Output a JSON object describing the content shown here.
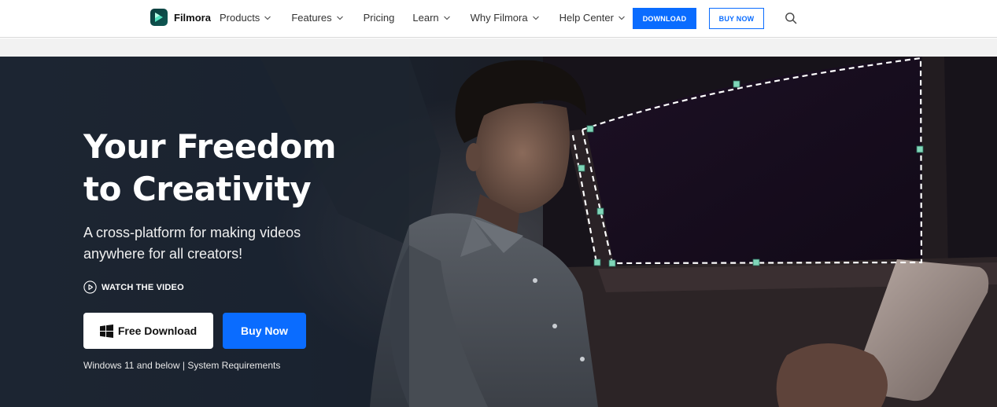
{
  "brand": {
    "name": "Filmora",
    "logo_icon": "filmora-logo-icon"
  },
  "nav": {
    "items": [
      {
        "label": "Products",
        "has_dropdown": true
      },
      {
        "label": "Features",
        "has_dropdown": true
      },
      {
        "label": "Pricing",
        "has_dropdown": false
      },
      {
        "label": "Learn",
        "has_dropdown": true
      },
      {
        "label": "Why Filmora",
        "has_dropdown": true
      },
      {
        "label": "Help Center",
        "has_dropdown": true
      }
    ],
    "download_label": "DOWNLOAD",
    "buy_label": "BUY NOW",
    "search_icon": "search-icon"
  },
  "hero": {
    "title_line1": "Your Freedom",
    "title_line2": "to Creativity",
    "subtitle_line1": "A cross-platform for making videos",
    "subtitle_line2": "anywhere for all creators!",
    "watch_label": "WATCH THE VIDEO",
    "free_download_label": "Free Download",
    "buy_now_label": "Buy Now",
    "requirements_prefix": "Windows 11 and below | ",
    "requirements_link": "System Requirements"
  },
  "colors": {
    "primary_blue": "#0a6cff",
    "handle_teal": "#7fd6b8",
    "hero_bg": "#1a1d24"
  }
}
